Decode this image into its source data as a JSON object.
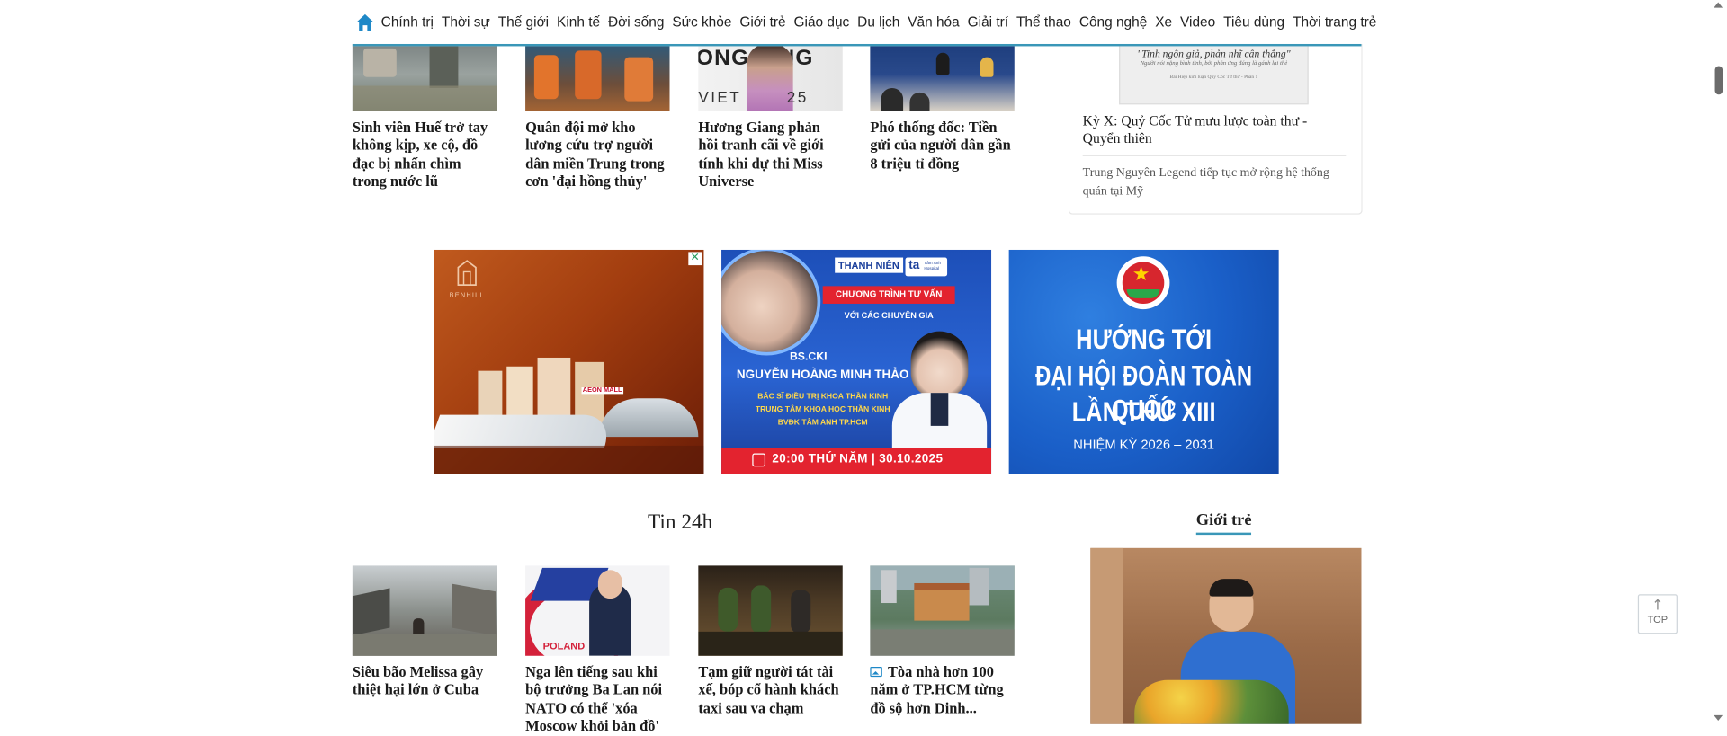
{
  "nav": {
    "items": [
      "Chính trị",
      "Thời sự",
      "Thế giới",
      "Kinh tế",
      "Đời sống",
      "Sức khỏe",
      "Giới trẻ",
      "Giáo dục",
      "Du lịch",
      "Văn hóa",
      "Giải trí",
      "Thể thao",
      "Công nghệ",
      "Xe",
      "Video",
      "Tiêu dùng",
      "Thời trang trẻ"
    ],
    "accent": "#3a97b8"
  },
  "top_articles": [
    {
      "title": "Sinh viên Huế trở tay không kịp, xe cộ, đồ đạc bị nhấn chìm trong nước lũ"
    },
    {
      "title": "Quân đội mở kho lương cứu trợ người dân miền Trung trong cơn 'đại hồng thủy'"
    },
    {
      "title": "Hương Giang phản hồi tranh cãi về giới tính khi dự thi Miss Universe"
    },
    {
      "title": "Phó thống đốc: Tiền gửi của người dân gần 8 triệu tỉ đồng"
    }
  ],
  "side": {
    "quote_line1": "\"Tinh ngôn giả, phản nhĩ cân thẳng\"",
    "quote_line2": "Người nói nặng bình tĩnh, bởi phản ứng đúng là gánh lại thẻ",
    "quote_credit": "Bài Hiệp kim luận Quý Cốc Tử thư - Phần 1",
    "item1": "Kỳ X: Quỷ Cốc Tử mưu lược toàn thư - Quyển thiên",
    "item2": "Trung Nguyên Legend tiếp tục mở rộng hệ thống quán tại Mỹ"
  },
  "ads": {
    "benhill": {
      "brand": "BENHILL",
      "mall_sign": "AEON MALL"
    },
    "thanhnien": {
      "logo_left": "THANH NIÊN",
      "logo_right": "ta",
      "logo_right_sub": "Tâm Anh Hospital",
      "banner": "CHƯƠNG TRÌNH TƯ VẤN",
      "subtitle": "VỚI CÁC CHUYÊN GIA",
      "degree": "BS.CKI",
      "name": "NGUYỄN HOÀNG MINH THẢO",
      "role1": "BÁC SĨ ĐIỀU TRỊ KHOA THẦN KINH",
      "role2": "TRUNG TÂM KHOA HỌC THẦN KINH",
      "role3": "BVĐK TÂM ANH TP.HCM",
      "time": "20:00 THỨ NĂM | 30.10.2025"
    },
    "doan": {
      "line1": "HƯỚNG TỚI",
      "line2": "ĐẠI HỘI ĐOÀN TOÀN QUỐC",
      "line3": "LẦN THỨ XIII",
      "term": "NHIỆM KỲ 2026 – 2031"
    }
  },
  "sections": {
    "tin24h": "Tin 24h",
    "gioitre": "Giới trẻ"
  },
  "bottom_articles": [
    {
      "title": "Siêu bão Melissa gây thiệt hại lớn ở Cuba"
    },
    {
      "title": "Nga lên tiếng sau khi bộ trưởng Ba Lan nói NATO có thể 'xóa Moscow khỏi bản đồ'"
    },
    {
      "title": "Tạm giữ người tát tài xế, bóp cổ hành khách taxi sau va chạm"
    },
    {
      "title": "Tòa nhà hơn 100 năm ở TP.HCM từng đồ sộ hơn Dinh..."
    }
  ],
  "poland_word": "POLAND",
  "top_button": "TOP"
}
